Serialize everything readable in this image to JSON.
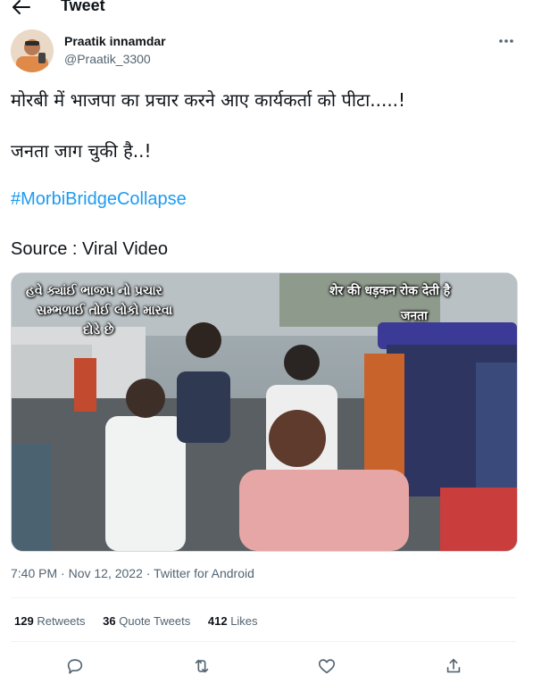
{
  "header": {
    "title": "Tweet"
  },
  "author": {
    "name": "Praatik innamdar",
    "handle": "@Praatik_3300"
  },
  "tweet": {
    "line1": "मोरबी में भाजपा का प्रचार करने आए कार्यकर्ता को पीटा.....!",
    "line2": "जनता जाग चुकी है..!",
    "hashtag": "#MorbiBridgeCollapse",
    "source": "Source : Viral Video"
  },
  "media": {
    "caption_left_1": "હવે ક્યાંઈ ભાજપ નો પ્રચાર",
    "caption_left_2": "સમ્ભળાઈ તોઈ લોકો મારવા",
    "caption_left_3": "દોડે છે",
    "caption_right_1": "शेर की धड़कन रोक देती है",
    "caption_right_2": "जनता"
  },
  "meta": {
    "timestamp": "7:40 PM · Nov 12, 2022 · Twitter for Android"
  },
  "stats": {
    "retweets_count": "129",
    "retweets_label": "Retweets",
    "quotes_count": "36",
    "quotes_label": "Quote Tweets",
    "likes_count": "412",
    "likes_label": "Likes"
  },
  "icons": {
    "back": "arrow-left-icon",
    "more": "more-horizontal-icon",
    "reply": "reply-icon",
    "retweet": "retweet-icon",
    "like": "heart-icon",
    "share": "share-icon"
  },
  "colors": {
    "link": "#1d9bf0",
    "secondary_text": "#536471",
    "primary_text": "#0f1419"
  }
}
